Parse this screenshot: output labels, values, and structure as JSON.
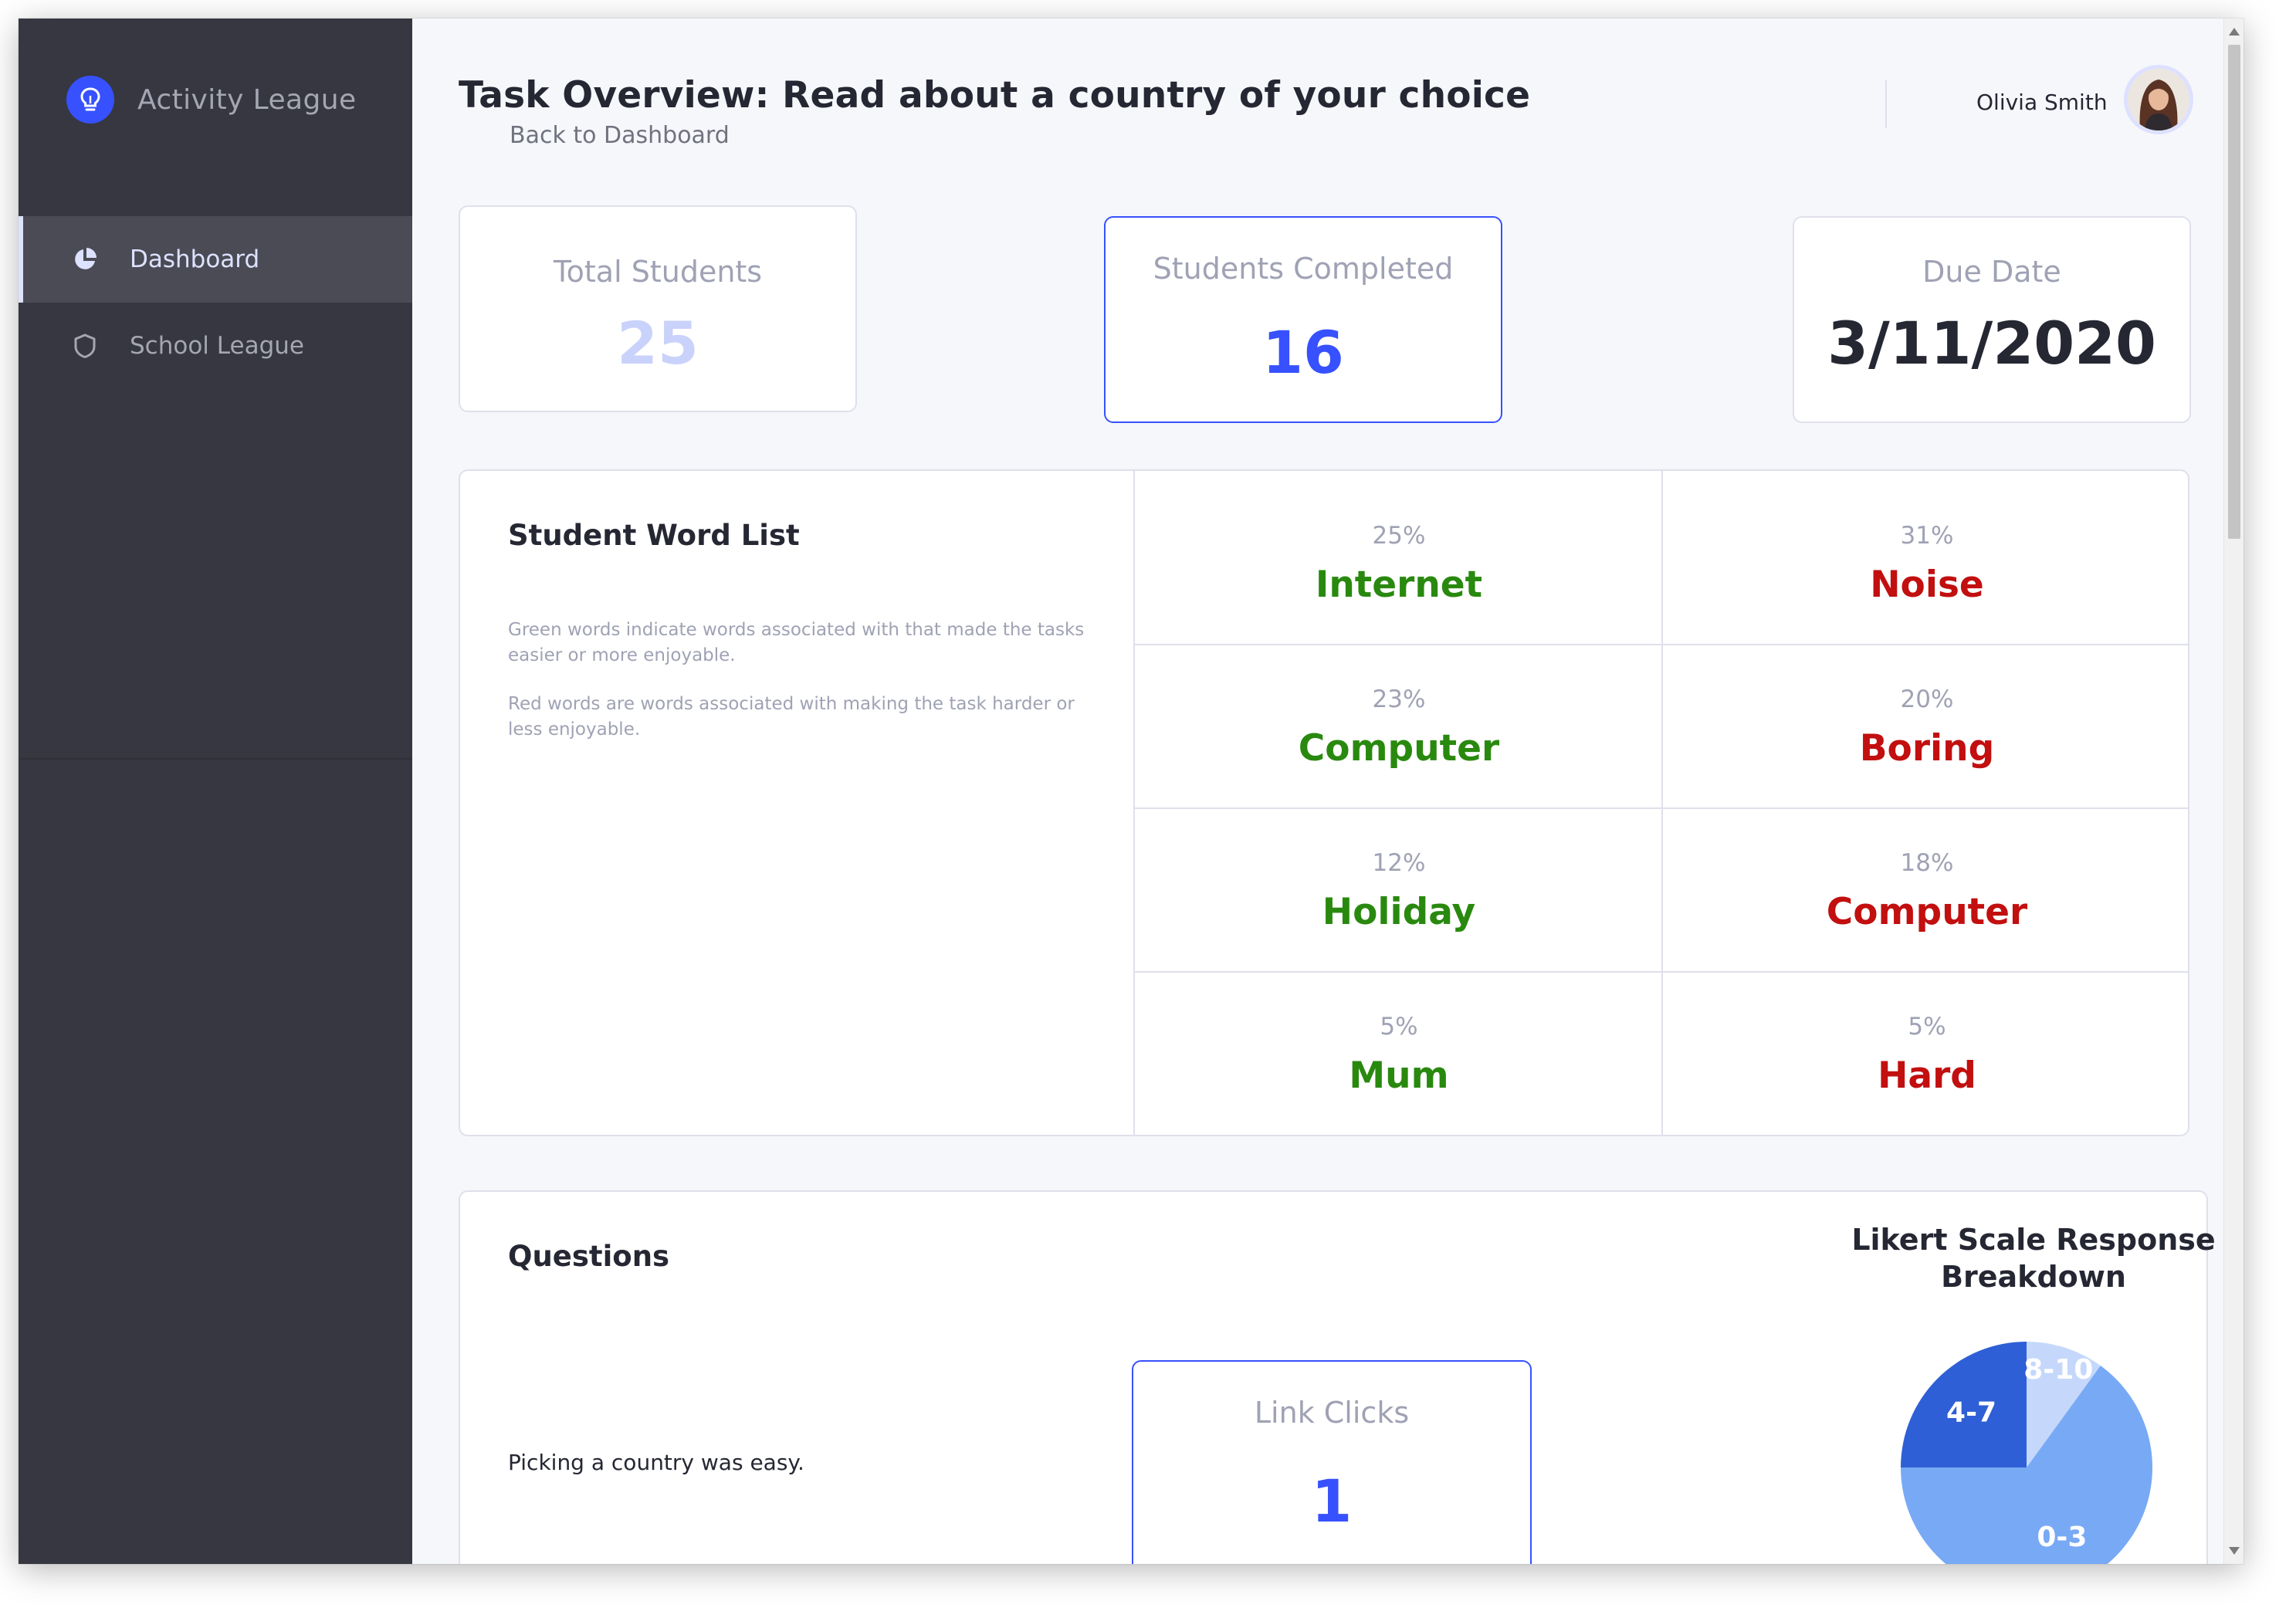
{
  "app": {
    "brand": "Activity League",
    "brand_icon": "lightbulb-icon",
    "accent_color": "#3751ff"
  },
  "sidebar": {
    "items": [
      {
        "label": "Dashboard",
        "icon": "pie-chart-icon",
        "active": true
      },
      {
        "label": "School League",
        "icon": "shield-icon",
        "active": false
      }
    ]
  },
  "header": {
    "title": "Task Overview: Read about a country of your choice",
    "back_link": "Back to Dashboard",
    "user_name": "Olivia Smith"
  },
  "stats": {
    "total_students": {
      "label": "Total Students",
      "value": "25"
    },
    "students_completed": {
      "label": "Students Completed",
      "value": "16"
    },
    "due_date": {
      "label": "Due Date",
      "value": "3/11/2020"
    }
  },
  "word_list": {
    "title": "Student Word List",
    "desc_green": "Green words indicate words associated with that made the tasks easier or more enjoyable.",
    "desc_red": "Red words are words associated with making the task harder or less enjoyable.",
    "good_color": "#29890f",
    "bad_color": "#c20f0f",
    "rows": [
      {
        "good": {
          "pct": "25%",
          "word": "Internet"
        },
        "bad": {
          "pct": "31%",
          "word": "Noise"
        }
      },
      {
        "good": {
          "pct": "23%",
          "word": "Computer"
        },
        "bad": {
          "pct": "20%",
          "word": "Boring"
        }
      },
      {
        "good": {
          "pct": "12%",
          "word": "Holiday"
        },
        "bad": {
          "pct": "18%",
          "word": "Computer"
        }
      },
      {
        "good": {
          "pct": "5%",
          "word": "Mum"
        },
        "bad": {
          "pct": "5%",
          "word": "Hard"
        }
      }
    ]
  },
  "questions": {
    "title": "Questions",
    "items": [
      {
        "text": "Picking a country was easy.",
        "link_clicks_label": "Link Clicks",
        "link_clicks_value": "1"
      }
    ]
  },
  "likert": {
    "title": "Likert Scale Response Breakdown",
    "slices": [
      {
        "label": "8-10",
        "fraction": 0.1,
        "color": "#c5d8fb"
      },
      {
        "label": "0-3",
        "fraction": 0.65,
        "color": "#78a9f5"
      },
      {
        "label": "4-7",
        "fraction": 0.25,
        "color": "#2f5fd6"
      }
    ]
  }
}
